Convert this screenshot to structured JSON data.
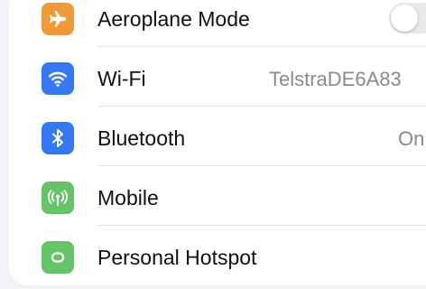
{
  "settings": {
    "rows": [
      {
        "label": "Aeroplane Mode",
        "icon": "aeroplane-icon",
        "icon_color": "#f09a37",
        "toggle_state": "off"
      },
      {
        "label": "Wi-Fi",
        "icon": "wifi-icon",
        "icon_color": "#3478f6",
        "value": "TelstraDE6A83"
      },
      {
        "label": "Bluetooth",
        "icon": "bluetooth-icon",
        "icon_color": "#3478f6",
        "value": "On"
      },
      {
        "label": "Mobile",
        "icon": "antenna-icon",
        "icon_color": "#65c466"
      },
      {
        "label": "Personal Hotspot",
        "icon": "hotspot-icon",
        "icon_color": "#65c466"
      }
    ]
  }
}
